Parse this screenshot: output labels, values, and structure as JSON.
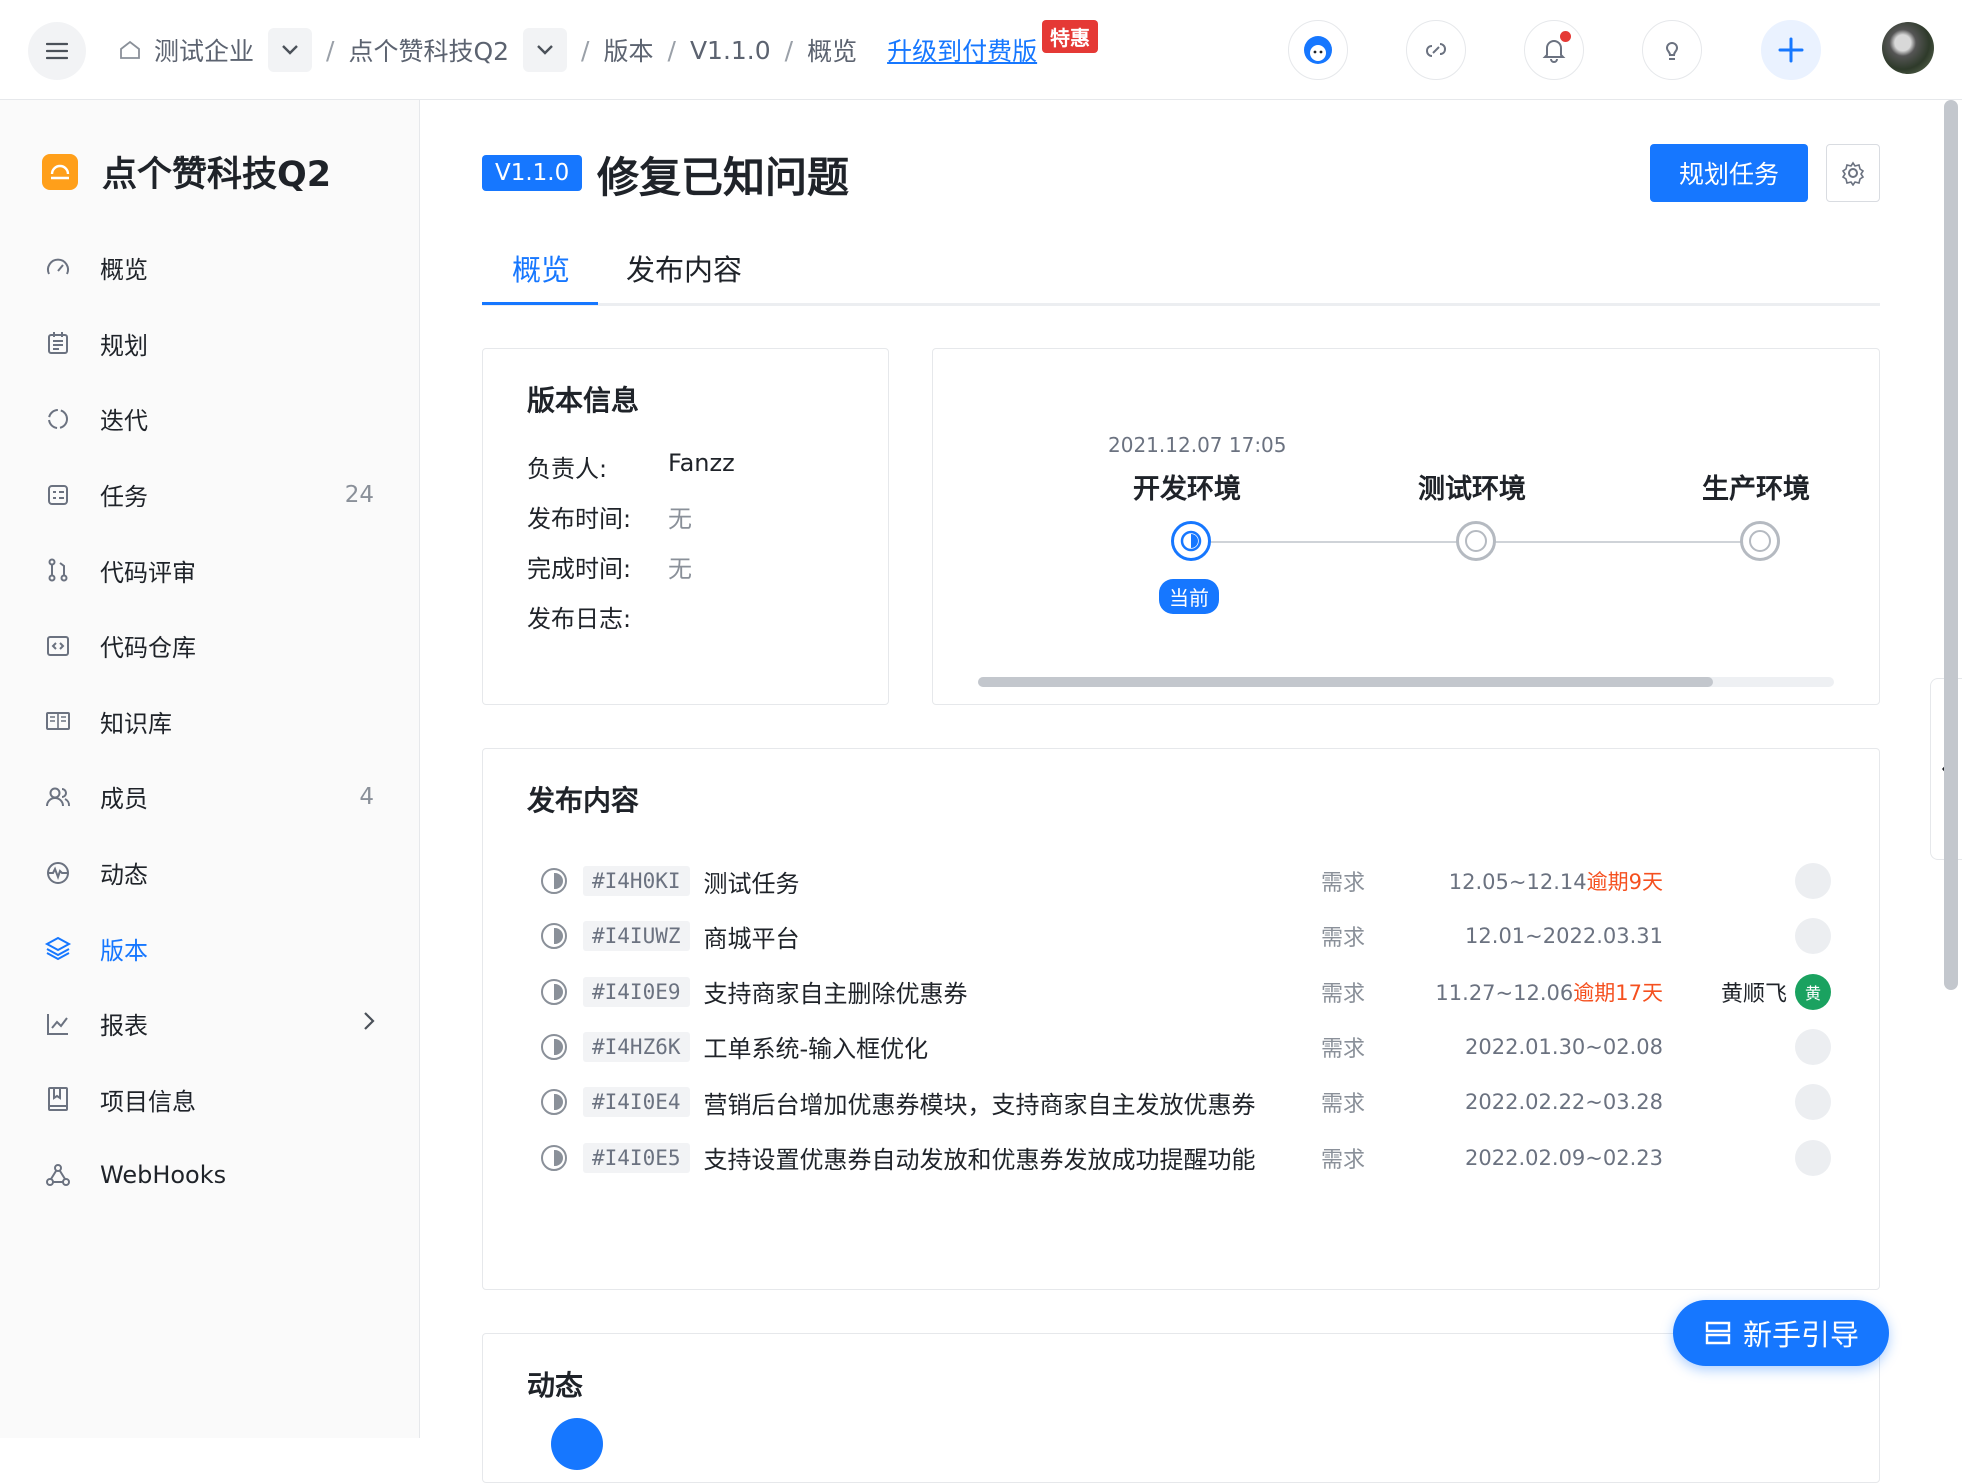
{
  "topbar": {
    "breadcrumbs": [
      "测试企业",
      "点个赞科技Q2",
      "版本",
      "V1.1.0",
      "概览"
    ],
    "upgrade_link": "升级到付费版",
    "promo_badge": "特惠"
  },
  "sidebar": {
    "project_name": "点个赞科技Q2",
    "items": [
      {
        "label": "概览",
        "count": "",
        "icon": "dashboard-icon"
      },
      {
        "label": "规划",
        "count": "",
        "icon": "calendar-icon"
      },
      {
        "label": "迭代",
        "count": "",
        "icon": "cycle-icon"
      },
      {
        "label": "任务",
        "count": "24",
        "icon": "task-icon"
      },
      {
        "label": "代码评审",
        "count": "",
        "icon": "pull-request-icon"
      },
      {
        "label": "代码仓库",
        "count": "",
        "icon": "code-icon"
      },
      {
        "label": "知识库",
        "count": "",
        "icon": "book-icon"
      },
      {
        "label": "成员",
        "count": "4",
        "icon": "members-icon"
      },
      {
        "label": "动态",
        "count": "",
        "icon": "activity-icon"
      },
      {
        "label": "版本",
        "count": "",
        "icon": "layers-icon",
        "active": true
      },
      {
        "label": "报表",
        "count": "",
        "icon": "chart-icon"
      },
      {
        "label": "项目信息",
        "count": "",
        "icon": "project-info-icon"
      },
      {
        "label": "WebHooks",
        "count": "",
        "icon": "webhook-icon"
      }
    ]
  },
  "header": {
    "version_badge": "V1.1.0",
    "title": "修复已知问题",
    "plan_button": "规划任务"
  },
  "tabs": [
    "概览",
    "发布内容"
  ],
  "version_info": {
    "title": "版本信息",
    "rows": [
      {
        "k": "负责人:",
        "v": "Fanzz"
      },
      {
        "k": "发布时间:",
        "v": "无"
      },
      {
        "k": "完成时间:",
        "v": "无"
      },
      {
        "k": "发布日志:",
        "v": ""
      }
    ]
  },
  "environments": {
    "current_time": "2021.12.07 17:05",
    "current_tag": "当前",
    "stages": [
      "开发环境",
      "测试环境",
      "生产环境"
    ]
  },
  "release_content": {
    "title": "发布内容",
    "items": [
      {
        "id": "#I4H0KI",
        "name": "测试任务",
        "type": "需求",
        "date": "12.05~12.14",
        "overdue": "逾期9天",
        "assignee": ""
      },
      {
        "id": "#I4IUWZ",
        "name": "商城平台",
        "type": "需求",
        "date": "12.01~2022.03.31",
        "overdue": "",
        "assignee": ""
      },
      {
        "id": "#I4I0E9",
        "name": "支持商家自主删除优惠券",
        "type": "需求",
        "date": "11.27~12.06",
        "overdue": "逾期17天",
        "assignee": "黄顺飞",
        "assignee_initial": "黄"
      },
      {
        "id": "#I4HZ6K",
        "name": "工单系统-输入框优化",
        "type": "需求",
        "date": "2022.01.30~02.08",
        "overdue": "",
        "assignee": ""
      },
      {
        "id": "#I4I0E4",
        "name": "营销后台增加优惠券模块，支持商家自主发放优惠券",
        "type": "需求",
        "date": "2022.02.22~03.28",
        "overdue": "",
        "assignee": ""
      },
      {
        "id": "#I4I0E5",
        "name": "支持设置优惠券自动发放和优惠券发放成功提醒功能",
        "type": "需求",
        "date": "2022.02.09~02.23",
        "overdue": "",
        "assignee": ""
      }
    ]
  },
  "activity": {
    "title": "动态"
  },
  "guide_button": "新手引导",
  "colors": {
    "accent": "#1677ff",
    "overdue": "#f5501f",
    "promo": "#e53935",
    "logo": "#ff9f1a",
    "assignee": "#1aa260"
  }
}
